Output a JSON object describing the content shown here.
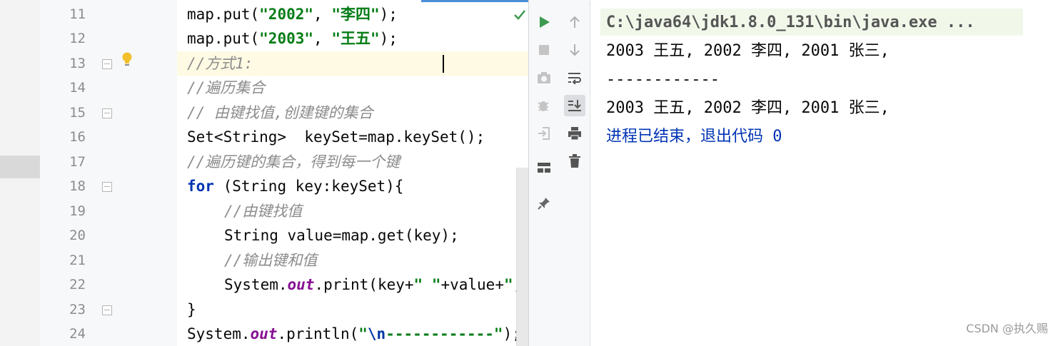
{
  "gutter": {
    "line_numbers": [
      "11",
      "12",
      "13",
      "14",
      "15",
      "16",
      "17",
      "18",
      "19",
      "20",
      "21",
      "22",
      "23",
      "24"
    ]
  },
  "code": {
    "line11": {
      "prefix": "map.put(",
      "str1": "\"2002\"",
      "sep": ", ",
      "str2": "\"李四\"",
      "suffix": ");"
    },
    "line12": {
      "prefix": "map.put(",
      "str1": "\"2003\"",
      "sep": ", ",
      "str2": "\"王五\"",
      "suffix": ");"
    },
    "line13": {
      "comment": "//方式1:"
    },
    "line14": {
      "comment": "//遍历集合"
    },
    "line15": {
      "comment": "// 由键找值,创建键的集合"
    },
    "line16": {
      "text": "Set<String>  keySet=map.keySet();"
    },
    "line17": {
      "comment": "//遍历键的集合，得到每一个键"
    },
    "line18": {
      "keyword": "for",
      "text": " (String key:keySet){"
    },
    "line19": {
      "comment": "//由键找值"
    },
    "line20": {
      "text": "String value=map.get(key);"
    },
    "line21": {
      "comment": "//输出键和值"
    },
    "line22": {
      "prefix": "System.",
      "field": "out",
      "middle": ".print(key+",
      "str1": "\" \"",
      "after": "+value+",
      "str2": "\","
    },
    "line23": {
      "text": "}"
    },
    "line24": {
      "prefix": "System.",
      "field": "out",
      "middle": ".println(",
      "quote_open": "\"",
      "escape": "\\n",
      "dashes": "------------",
      "quote_close": "\"",
      "suffix": ");"
    }
  },
  "console": {
    "command": "C:\\java64\\jdk1.8.0_131\\bin\\java.exe ...",
    "output1": "2003 王五, 2002 李四, 2001 张三,",
    "separator": "------------",
    "output2": "2003 王五, 2002 李四, 2001 张三,",
    "exit_message": "进程已结束，退出代码 0"
  },
  "run_toolbar": {
    "col1_icons": [
      "run-icon",
      "stop-icon",
      "camera-icon",
      "debug-icon",
      "login-icon",
      "layout-icon",
      "pin-icon"
    ],
    "col2_icons": [
      "up-arrow-icon",
      "down-arrow-icon",
      "soft-wrap-icon",
      "scroll-to-end-icon",
      "print-icon",
      "trash-icon"
    ]
  },
  "watermark": "CSDN @执久赐",
  "colors": {
    "keyword": "#0033b3",
    "string": "#067d17",
    "comment": "#8c8c8c",
    "field": "#871094",
    "run_green": "#3d9a50"
  }
}
